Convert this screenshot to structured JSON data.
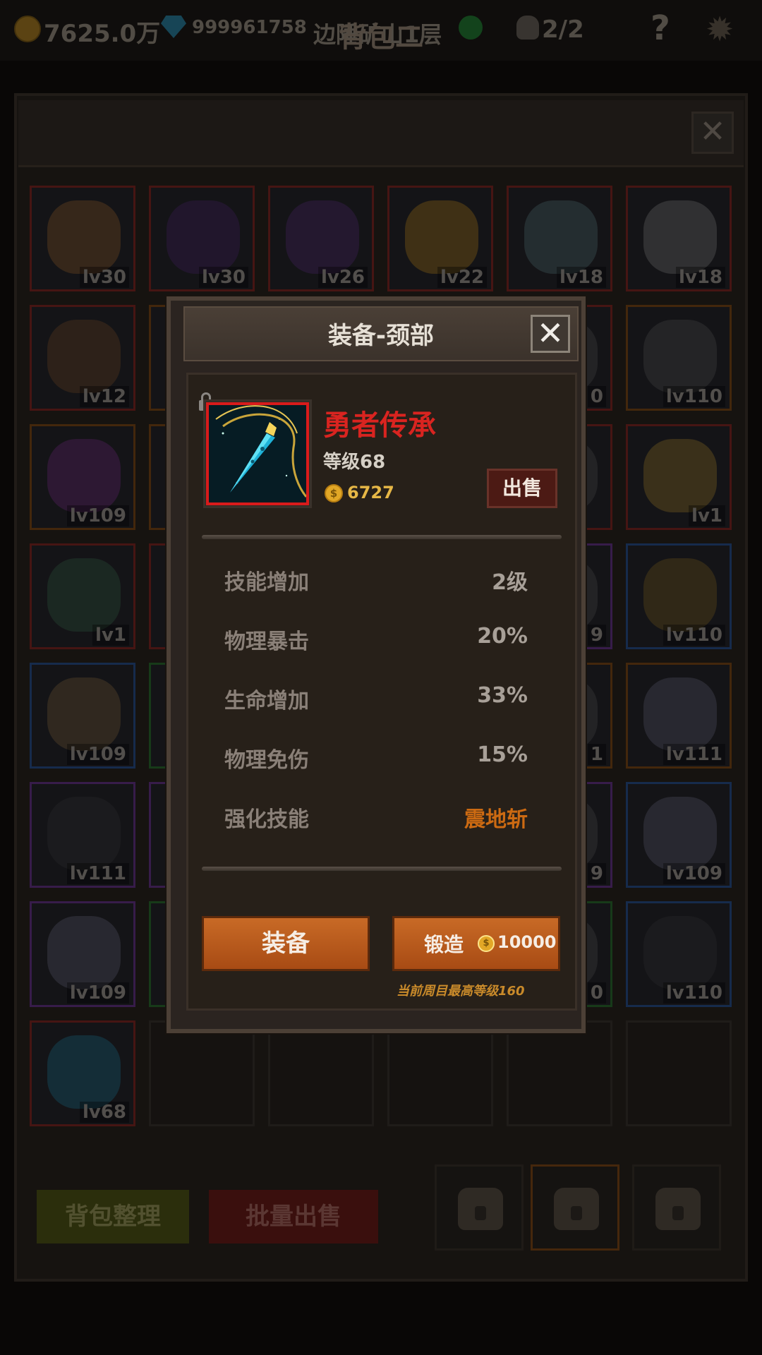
{
  "topbar": {
    "gold": "7625.0万",
    "gems": "999961758",
    "location": "边陲矿山1层",
    "kills": "2/2",
    "help": "?",
    "gear": "✹"
  },
  "bag": {
    "title": "背包二",
    "close": "✕",
    "slots": [
      {
        "border": "red",
        "lv": "lv30",
        "color": "#a0652c"
      },
      {
        "border": "red",
        "lv": "lv30",
        "color": "#4c2670"
      },
      {
        "border": "red",
        "lv": "lv26",
        "color": "#5a2a7a"
      },
      {
        "border": "red",
        "lv": "lv22",
        "color": "#c08a18"
      },
      {
        "border": "red",
        "lv": "lv18",
        "color": "#5c7a80"
      },
      {
        "border": "red",
        "lv": "lv18",
        "color": "#8a8a88"
      },
      {
        "border": "red",
        "lv": "lv12",
        "color": "#7a5028"
      },
      {
        "border": "orange",
        "lv": "",
        "color": "#555"
      },
      {
        "border": "red",
        "lv": "",
        "color": "#555"
      },
      {
        "border": "red",
        "lv": "",
        "color": "#555"
      },
      {
        "border": "red",
        "lv": "0",
        "color": "#555"
      },
      {
        "border": "orange",
        "lv": "lv110",
        "color": "#5a5a5a"
      },
      {
        "border": "orange",
        "lv": "lv109",
        "color": "#7a2a8a"
      },
      {
        "border": "orange",
        "lv": "",
        "color": "#555"
      },
      {
        "border": "red",
        "lv": "",
        "color": "#555"
      },
      {
        "border": "red",
        "lv": "",
        "color": "#555"
      },
      {
        "border": "red",
        "lv": "",
        "color": "#555"
      },
      {
        "border": "red",
        "lv": "lv1",
        "color": "#b08a2a"
      },
      {
        "border": "red",
        "lv": "lv1",
        "color": "#3a6a4a"
      },
      {
        "border": "red",
        "lv": "",
        "color": "#555"
      },
      {
        "border": "red",
        "lv": "",
        "color": "#555"
      },
      {
        "border": "red",
        "lv": "",
        "color": "#555"
      },
      {
        "border": "purple",
        "lv": "9",
        "color": "#555"
      },
      {
        "border": "blue",
        "lv": "lv110",
        "color": "#8a6a20"
      },
      {
        "border": "blue",
        "lv": "lv109",
        "color": "#8a6a40"
      },
      {
        "border": "green",
        "lv": "",
        "color": "#555"
      },
      {
        "border": "red",
        "lv": "",
        "color": "#555"
      },
      {
        "border": "red",
        "lv": "",
        "color": "#555"
      },
      {
        "border": "orange",
        "lv": "1",
        "color": "#555"
      },
      {
        "border": "orange",
        "lv": "lv111",
        "color": "#6a6a80"
      },
      {
        "border": "purple",
        "lv": "lv111",
        "color": "#3a3a3a"
      },
      {
        "border": "purple",
        "lv": "",
        "color": "#555"
      },
      {
        "border": "red",
        "lv": "",
        "color": "#555"
      },
      {
        "border": "red",
        "lv": "",
        "color": "#555"
      },
      {
        "border": "purple",
        "lv": "9",
        "color": "#555"
      },
      {
        "border": "blue",
        "lv": "lv109",
        "color": "#6a6a80"
      },
      {
        "border": "purple",
        "lv": "lv109",
        "color": "#6a6a80"
      },
      {
        "border": "green",
        "lv": "",
        "color": "#555"
      },
      {
        "border": "red",
        "lv": "",
        "color": "#555"
      },
      {
        "border": "red",
        "lv": "",
        "color": "#555"
      },
      {
        "border": "green",
        "lv": "0",
        "color": "#555"
      },
      {
        "border": "blue",
        "lv": "lv110",
        "color": "#3a3a3a"
      },
      {
        "border": "red",
        "lv": "lv68",
        "color": "#1e7a9a"
      },
      {
        "border": "empty",
        "lv": "",
        "color": ""
      },
      {
        "border": "empty",
        "lv": "",
        "color": ""
      },
      {
        "border": "empty",
        "lv": "",
        "color": ""
      },
      {
        "border": "empty",
        "lv": "",
        "color": ""
      },
      {
        "border": "empty",
        "lv": "",
        "color": ""
      }
    ],
    "sort_label": "背包整理",
    "bulk_sell_label": "批量出售"
  },
  "modal": {
    "title": "装备-颈部",
    "close": "✕",
    "item_name": "勇者传承",
    "item_level": "等级68",
    "coin_symbol": "$",
    "price": "6727",
    "sell_label": "出售",
    "stats": [
      {
        "label": "技能增加",
        "value": "2级"
      },
      {
        "label": "物理暴击",
        "value": "20%"
      },
      {
        "label": "生命增加",
        "value": "33%"
      },
      {
        "label": "物理免伤",
        "value": "15%"
      },
      {
        "label": "强化技能",
        "value": "震地斩"
      }
    ],
    "equip_label": "装备",
    "forge_label": "锻造",
    "forge_cost": "10000",
    "max_level_note": "当前周目最高等级160"
  },
  "colors": {
    "item_name": "#d92420",
    "skill_value": "#cc6a12",
    "button": "#b85a1c",
    "price": "#e6b746"
  }
}
